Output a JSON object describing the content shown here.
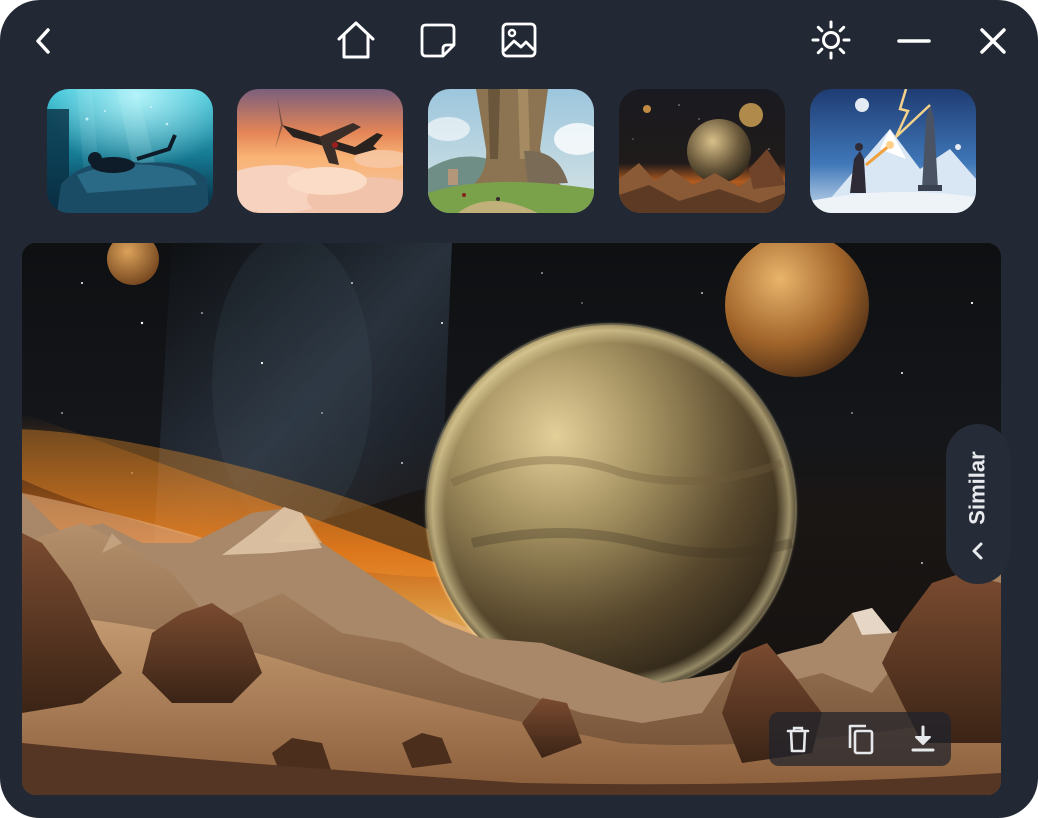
{
  "window": {
    "background": "#232934",
    "icon_color": "#ffffff"
  },
  "topbar": {
    "left": [
      {
        "icon": "back-chevron-icon"
      }
    ],
    "center": [
      {
        "icon": "home-icon"
      },
      {
        "icon": "sticky-note-icon"
      },
      {
        "icon": "image-icon"
      }
    ],
    "right": [
      {
        "icon": "sun-brightness-icon"
      },
      {
        "icon": "minimize-icon"
      },
      {
        "icon": "close-icon"
      }
    ]
  },
  "thumbnails": [
    {
      "subject": "underwater-bedroom"
    },
    {
      "subject": "warplane-sunset-clouds"
    },
    {
      "subject": "giant-tree-tower-village"
    },
    {
      "subject": "planets-desert-landscape"
    },
    {
      "subject": "wizard-lightning-tower"
    }
  ],
  "main_image": {
    "subject": "planets-over-desert-mountains"
  },
  "similar_tab": {
    "label": "Similar",
    "icon": "chevron-left-icon"
  },
  "action_bar": [
    {
      "icon": "trash-icon"
    },
    {
      "icon": "copy-icon"
    },
    {
      "icon": "download-icon"
    }
  ]
}
